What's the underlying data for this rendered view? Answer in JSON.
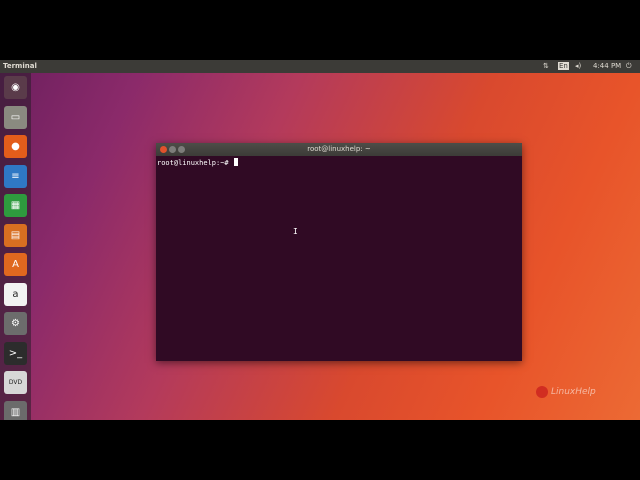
{
  "topbar": {
    "app_title": "Terminal",
    "keyboard_layout": "En",
    "clock": "4:44 PM"
  },
  "launcher": {
    "items": [
      {
        "name": "ubuntu-dash-icon",
        "glyph": "◉",
        "bg": "#5a3b4a"
      },
      {
        "name": "files-icon",
        "glyph": "▭",
        "bg": "#8a8a80"
      },
      {
        "name": "firefox-icon",
        "glyph": "●",
        "bg": "#e35d1b"
      },
      {
        "name": "writer-icon",
        "glyph": "≡",
        "bg": "#2f78c4"
      },
      {
        "name": "calc-icon",
        "glyph": "▦",
        "bg": "#2e9b3e"
      },
      {
        "name": "impress-icon",
        "glyph": "▤",
        "bg": "#d86f21"
      },
      {
        "name": "software-center-icon",
        "glyph": "A",
        "bg": "#e0681f"
      },
      {
        "name": "amazon-icon",
        "glyph": "a",
        "bg": "#f2f2f2"
      },
      {
        "name": "settings-icon",
        "glyph": "⚙",
        "bg": "#6c6c6c"
      },
      {
        "name": "terminal-icon",
        "glyph": ">_",
        "bg": "#2c2c2c"
      },
      {
        "name": "dvd-icon",
        "glyph": "DVD",
        "bg": "#d7d7d7"
      },
      {
        "name": "trash-icon",
        "glyph": "▥",
        "bg": "#6b6b6b"
      }
    ]
  },
  "terminal": {
    "window_title": "root@linuxhelp: ~",
    "prompt": "root@linuxhelp:~# "
  },
  "watermark": {
    "text": "LinuxHelp"
  },
  "colors": {
    "terminal_bg": "#300a24",
    "panel_bg": "#3c3b37"
  }
}
